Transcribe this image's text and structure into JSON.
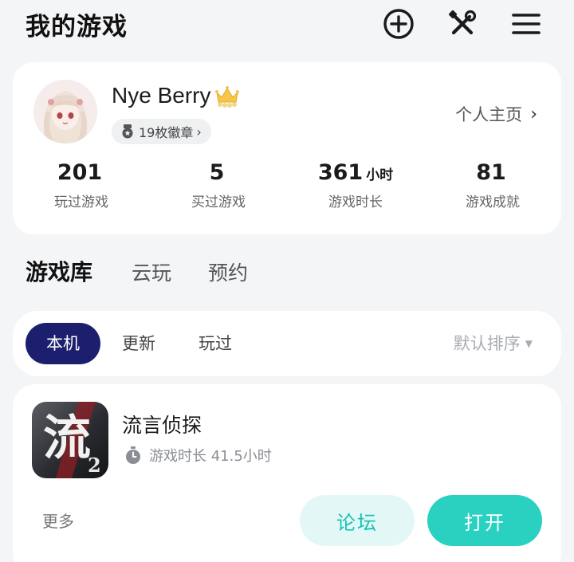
{
  "header": {
    "title": "我的游戏",
    "icons": [
      "add-circle-icon",
      "tools-icon",
      "menu-icon"
    ]
  },
  "profile": {
    "username": "Nye Berry",
    "badge_text": "19枚徽章",
    "profile_link": "个人主页",
    "stats": [
      {
        "value": "201",
        "unit": "",
        "label": "玩过游戏"
      },
      {
        "value": "5",
        "unit": "",
        "label": "买过游戏"
      },
      {
        "value": "361",
        "unit": "小时",
        "label": "游戏时长"
      },
      {
        "value": "81",
        "unit": "",
        "label": "游戏成就"
      }
    ]
  },
  "main_tabs": [
    {
      "label": "游戏库",
      "active": true
    },
    {
      "label": "云玩",
      "active": false
    },
    {
      "label": "预约",
      "active": false
    }
  ],
  "sub_tabs": [
    {
      "label": "本机",
      "active": true
    },
    {
      "label": "更新",
      "active": false
    },
    {
      "label": "玩过",
      "active": false
    }
  ],
  "sort": {
    "label": "默认排序"
  },
  "game": {
    "title": "流言侦探",
    "playtime": "游戏时长 41.5小时",
    "icon_char": "流",
    "icon_badge": "2",
    "more_label": "更多",
    "forum_label": "论坛",
    "open_label": "打开"
  },
  "colors": {
    "accent": "#2ad1c1",
    "accent_light": "#e3f8f6",
    "active_tab": "#1c1f6e",
    "background": "#f4f5f7"
  }
}
